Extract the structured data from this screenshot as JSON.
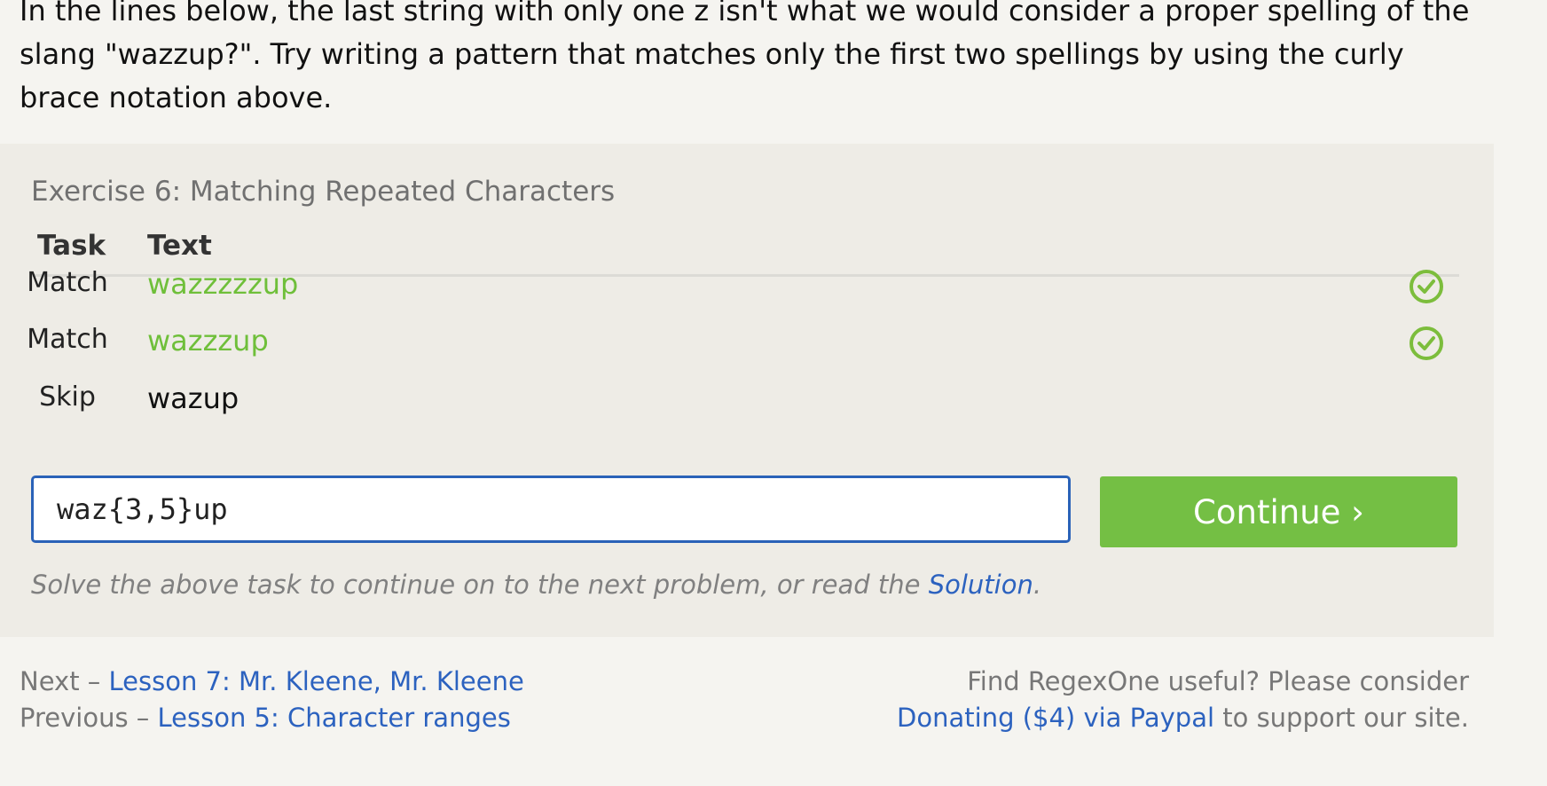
{
  "intro": {
    "text": "In the lines below, the last string with only one z isn't what we would consider a proper spelling of the slang \"wazzup?\". Try writing a pattern that matches only the first two spellings by using the curly brace notation above."
  },
  "exercise": {
    "title": "Exercise 6: Matching Repeated Characters",
    "headers": {
      "task": "Task",
      "text": "Text"
    },
    "rows": [
      {
        "task": "Match",
        "text": "wazzzzzup",
        "status": "matched"
      },
      {
        "task": "Match",
        "text": "wazzzup",
        "status": "matched"
      },
      {
        "task": "Skip",
        "text": "wazup",
        "status": "none"
      }
    ],
    "input": {
      "value": "waz{3,5}up"
    },
    "continue_label": "Continue ›",
    "hint": {
      "prefix": "Solve the above task to continue on to the next problem, or read the ",
      "link": "Solution",
      "suffix": "."
    }
  },
  "footer": {
    "next": {
      "prefix": "Next – ",
      "link": "Lesson 7: Mr. Kleene, Mr. Kleene"
    },
    "previous": {
      "prefix": "Previous – ",
      "link": "Lesson 5: Character ranges"
    },
    "donate": {
      "line1": "Find RegexOne useful? Please consider",
      "link": "Donating ($4) via Paypal",
      "suffix": " to support our site."
    }
  },
  "colors": {
    "match_green": "#6fbf3a",
    "button_green": "#74bf44",
    "link_blue": "#2c62bf",
    "input_border": "#2a62b8"
  },
  "icons": [
    "check-circle-icon"
  ]
}
